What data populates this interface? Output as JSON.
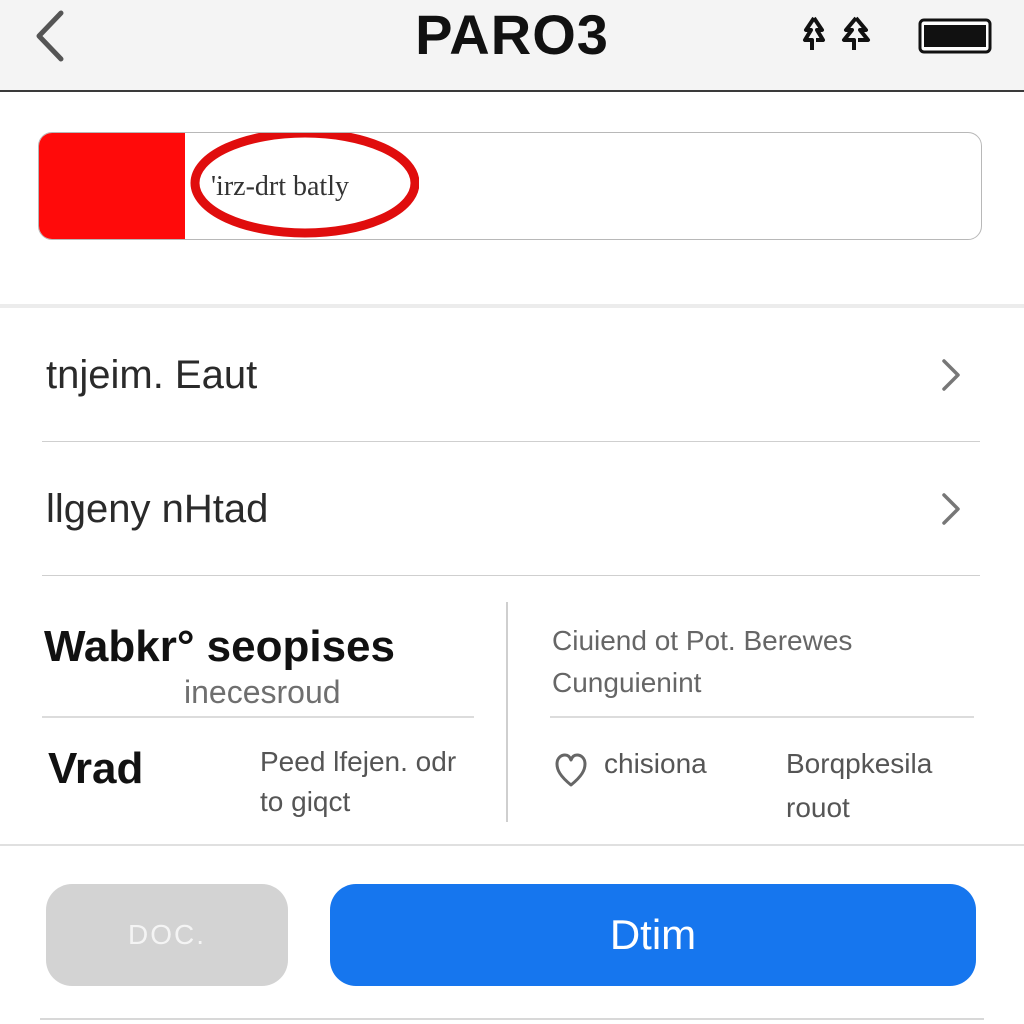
{
  "header": {
    "title": "PARO3",
    "back_icon": "chevron-left-icon",
    "signal_icon": "signal-icon",
    "battery_icon": "battery-icon"
  },
  "search": {
    "value": "'irz-drt batly",
    "highlight_color": "#ff0a0a",
    "ring_color": "#e00d0d"
  },
  "list": {
    "items": [
      {
        "label": "tnjeim. Eaut"
      },
      {
        "label": "llgeny nHtad"
      }
    ]
  },
  "details": {
    "feature_title": "Wabkr° seopises",
    "feature_sub": "inecesroud",
    "vrad_title": "Vrad",
    "vrad_note_line1": "Peed lfejen. odr",
    "vrad_note_line2": "to giqct",
    "right_head_line1": "Ciuiend ot  Pot. Berewes",
    "right_head_line2": "Cunguienint",
    "option_label": "chisiona",
    "option_right_line1": "Borqpkesila",
    "option_right_line2": "rouot"
  },
  "actions": {
    "secondary_label": "DOC.",
    "primary_label": "Dtim",
    "primary_color": "#1676ee"
  }
}
